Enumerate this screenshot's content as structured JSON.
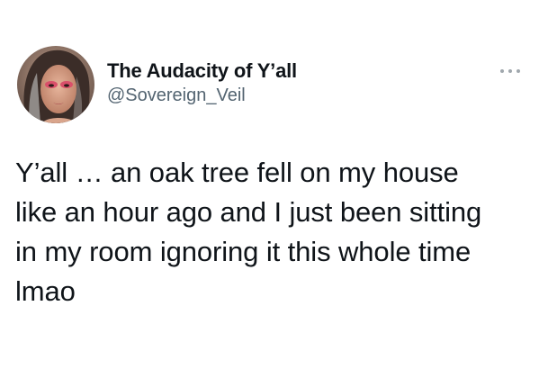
{
  "author": {
    "display_name": "The Audacity of Y’all",
    "handle": "@Sovereign_Veil",
    "avatar": "profile-photo"
  },
  "more_icon": "three-dots-icon",
  "tweet": {
    "lines": [
      "Y’all … an oak tree fell on my house",
      "like an hour ago and I just been sitting",
      "in my room ignoring it this whole time",
      "lmao"
    ]
  },
  "colors": {
    "text": "#0f1419",
    "secondary": "#536471",
    "background": "#ffffff"
  }
}
